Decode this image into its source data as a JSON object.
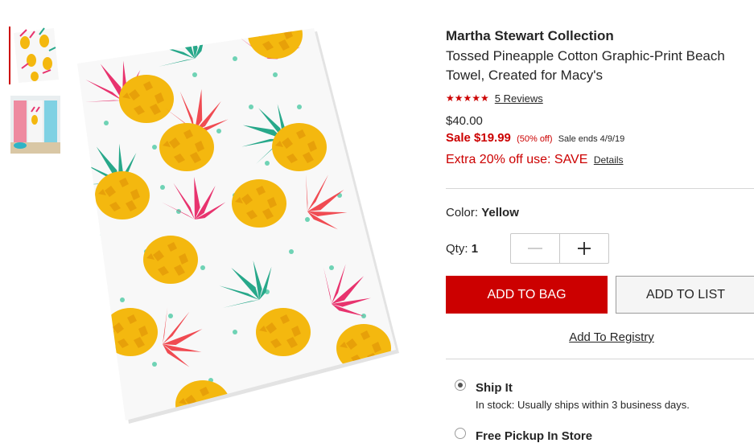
{
  "product": {
    "brand": "Martha Stewart Collection",
    "title": "Tossed Pineapple Cotton Graphic-Print Beach Towel, Created for Macy's",
    "stars": "★★★★★",
    "rating": 5,
    "reviews_label": "5 Reviews"
  },
  "pricing": {
    "original": "$40.00",
    "sale": "Sale $19.99",
    "discount": "(50% off)",
    "sale_ends": "Sale ends 4/9/19",
    "extra_offer": "Extra 20% off use: SAVE",
    "details_link": "Details"
  },
  "options": {
    "color_label": "Color:",
    "color_value": "Yellow",
    "qty_label": "Qty:",
    "qty_value": "1"
  },
  "actions": {
    "add_to_bag": "ADD TO BAG",
    "add_to_list": "ADD TO LIST",
    "add_to_registry": "Add To Registry"
  },
  "fulfillment": {
    "ship_title": "Ship It",
    "ship_subtitle": "In stock: Usually ships within 3 business days.",
    "pickup_title": "Free Pickup In Store"
  },
  "colors": {
    "accent_red": "#cc0000",
    "pineapple_yellow": "#f4b80f",
    "leaf_pink": "#e8336e",
    "leaf_teal": "#27a88a",
    "dot_mint": "#6fd3b5"
  }
}
